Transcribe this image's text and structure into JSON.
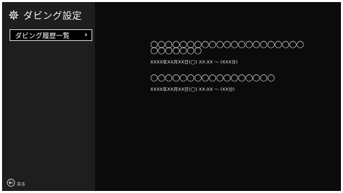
{
  "sidebar": {
    "icon": "gear-icon",
    "title": "ダビング設定",
    "menu": [
      {
        "label": "ダビング履歴一覧",
        "chevron": "›"
      }
    ],
    "back": {
      "icon": "back-arrow-icon",
      "label": "戻る"
    }
  },
  "history": [
    {
      "title": "◯◯◯◯◯◯◯◯◯◯◯◯◯◯◯◯◯◯◯◯◯◯◯◯◯◯◯◯",
      "datetime": "XXXX年XX月XX日(◯) XX:XX 〜 (XXX分)"
    },
    {
      "title": "◯◯◯◯◯◯◯◯◯◯◯◯◯◯◯◯◯",
      "datetime": "XXXX年XX月XX日(◯) XX:XX 〜 (XX分)"
    }
  ]
}
